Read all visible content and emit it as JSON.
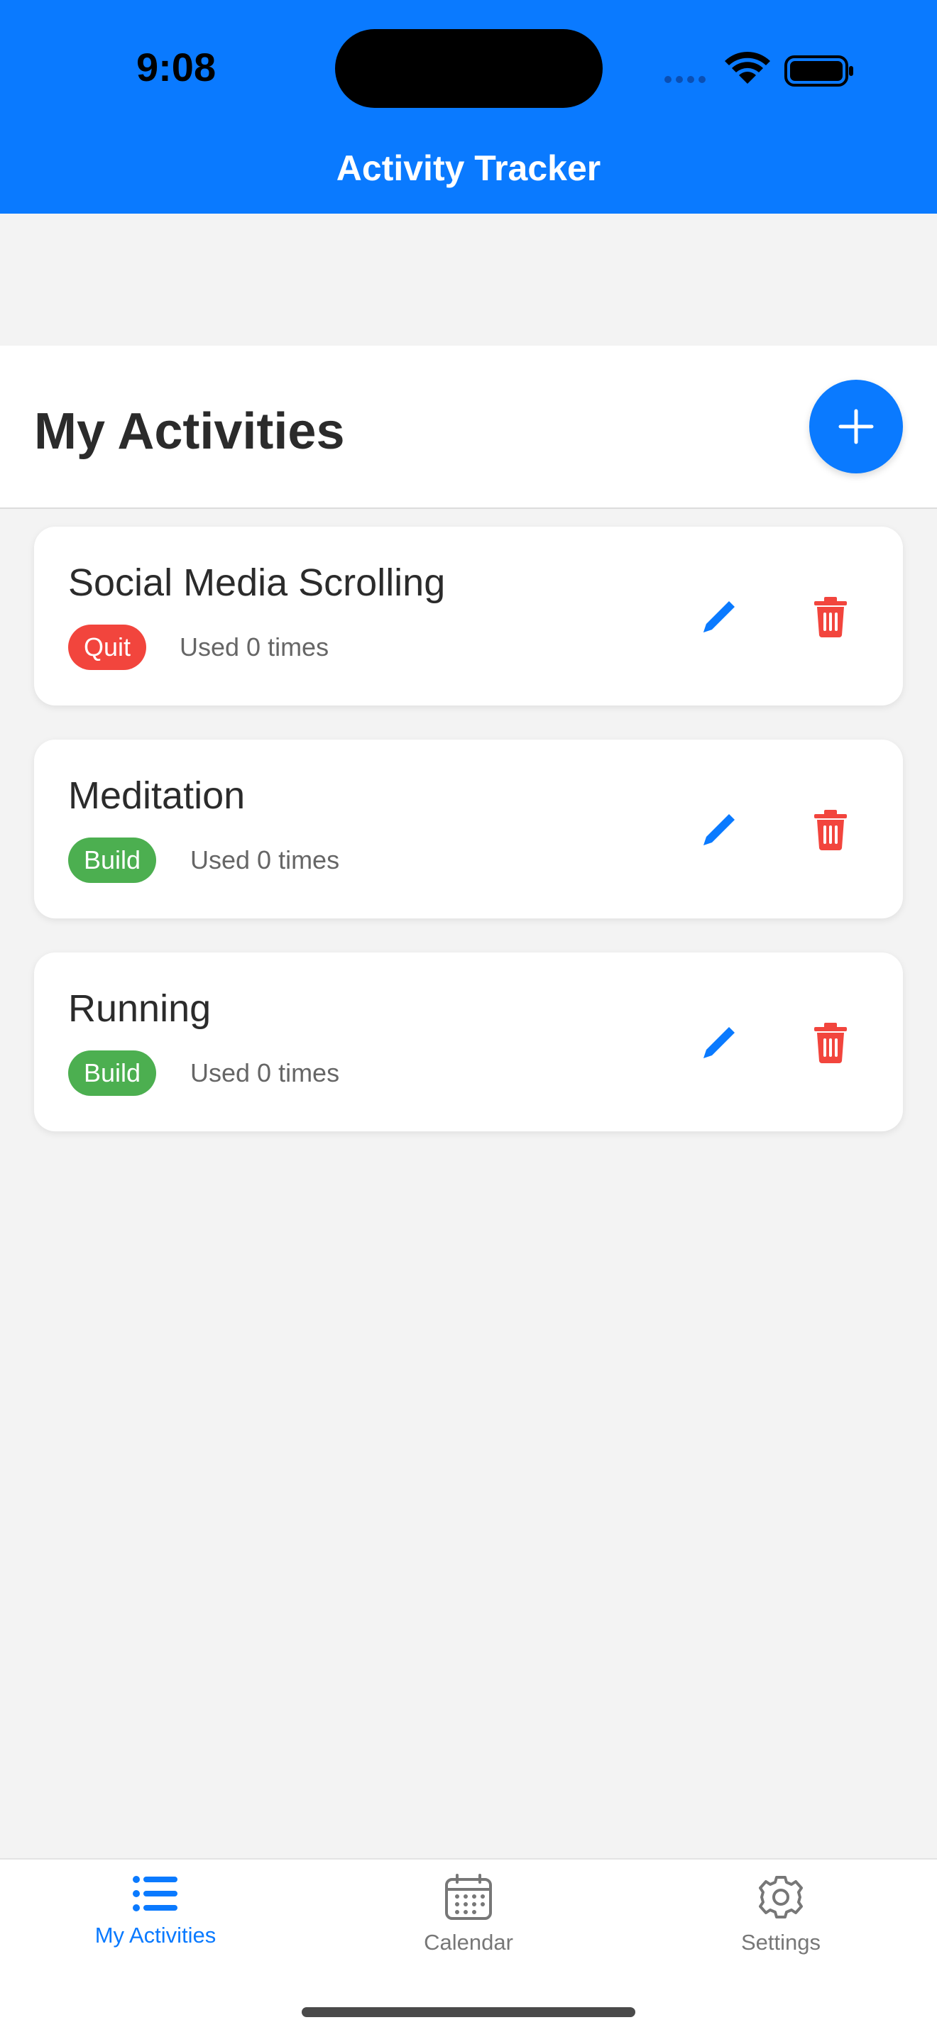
{
  "status_bar": {
    "time": "9:08"
  },
  "app": {
    "title": "Activity Tracker"
  },
  "header": {
    "title": "My Activities",
    "add_icon": "plus-icon"
  },
  "activities": [
    {
      "name": "Social Media Scrolling",
      "badge": "Quit",
      "usage": "Used 0 times"
    },
    {
      "name": "Meditation",
      "badge": "Build",
      "usage": "Used 0 times"
    },
    {
      "name": "Running",
      "badge": "Build",
      "usage": "Used 0 times"
    }
  ],
  "tabs": [
    {
      "label": "My Activities",
      "icon": "list-icon",
      "active": true
    },
    {
      "label": "Calendar",
      "icon": "calendar-icon",
      "active": false
    },
    {
      "label": "Settings",
      "icon": "gear-icon",
      "active": false
    }
  ],
  "colors": {
    "accent": "#0a7aff",
    "quit": "#f2453d",
    "build": "#4caf50",
    "delete": "#f2453d"
  }
}
